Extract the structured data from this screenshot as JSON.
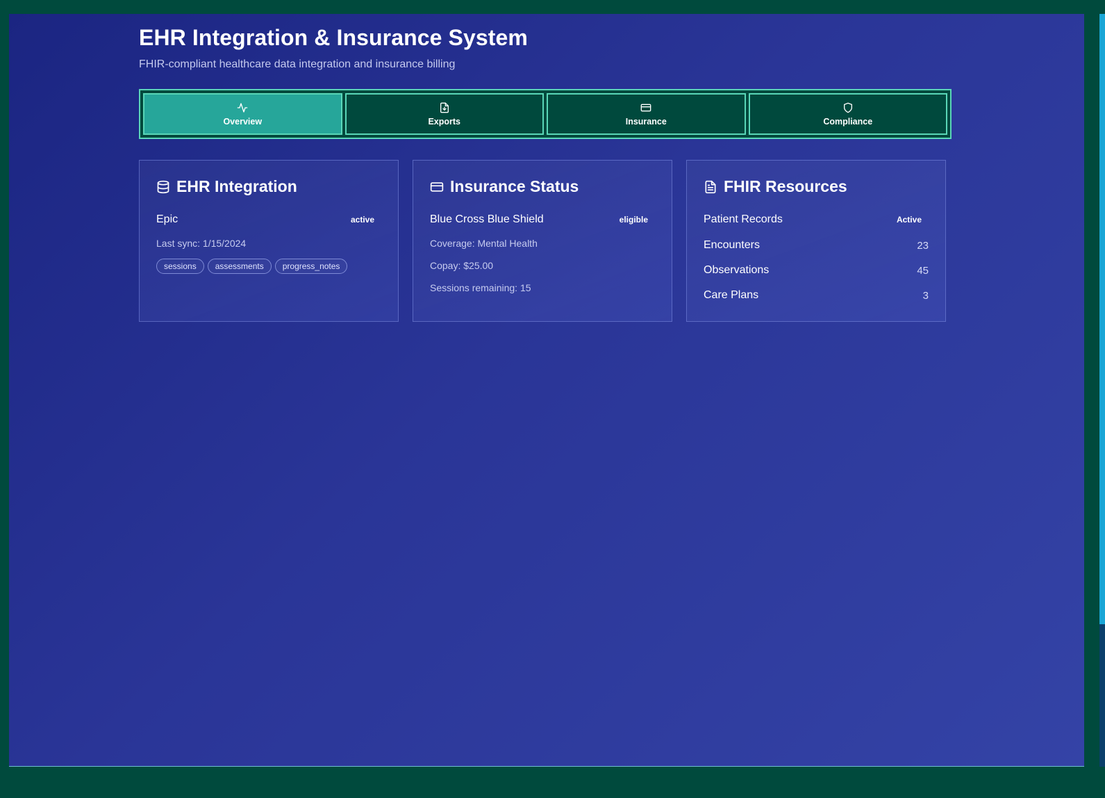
{
  "header": {
    "title": "EHR Integration & Insurance System",
    "subtitle": "FHIR-compliant healthcare data integration and insurance billing"
  },
  "tabs": [
    {
      "label": "Overview",
      "icon": "activity-icon",
      "active": true
    },
    {
      "label": "Exports",
      "icon": "file-download-icon",
      "active": false
    },
    {
      "label": "Insurance",
      "icon": "credit-card-icon",
      "active": false
    },
    {
      "label": "Compliance",
      "icon": "shield-icon",
      "active": false
    }
  ],
  "ehr_card": {
    "title": "EHR Integration",
    "icon": "database-icon",
    "system": "Epic",
    "status": "active",
    "last_sync": "Last sync: 1/15/2024",
    "tags": [
      "sessions",
      "assessments",
      "progress_notes"
    ]
  },
  "insurance_card": {
    "title": "Insurance Status",
    "icon": "credit-card-icon",
    "provider": "Blue Cross Blue Shield",
    "status": "eligible",
    "coverage": "Coverage: Mental Health",
    "copay": "Copay: $25.00",
    "sessions": "Sessions remaining: 15"
  },
  "fhir_card": {
    "title": "FHIR Resources",
    "icon": "document-icon",
    "rows": [
      {
        "label": "Patient Records",
        "value": "Active"
      },
      {
        "label": "Encounters",
        "value": "23"
      },
      {
        "label": "Observations",
        "value": "45"
      },
      {
        "label": "Care Plans",
        "value": "3"
      }
    ]
  },
  "colors": {
    "accent": "#26a69a",
    "tab_border": "#5ad6b7",
    "tab_bg": "#00493d",
    "page_bg_start": "#1b2582",
    "page_bg_end": "#3443a6"
  }
}
